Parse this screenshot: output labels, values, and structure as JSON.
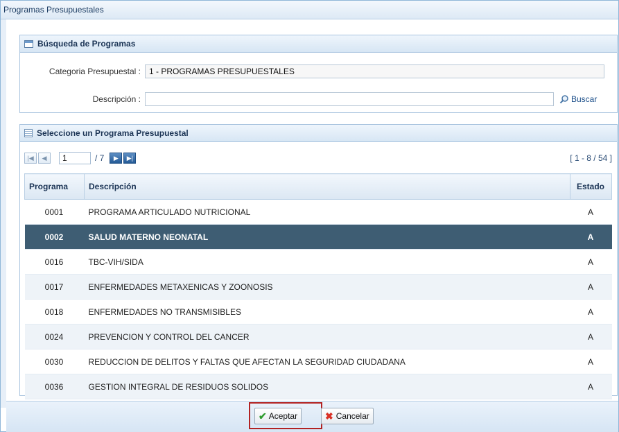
{
  "window": {
    "title": "Programas Presupuestales"
  },
  "search_panel": {
    "title": "Búsqueda de Programas",
    "categoria_label": "Categoria Presupuestal :",
    "categoria_value": "1 - PROGRAMAS PRESUPUESTALES",
    "descripcion_label": "Descripción :",
    "descripcion_value": "",
    "buscar_label": "Buscar"
  },
  "grid_panel": {
    "title": "Seleccione un Programa Presupuestal",
    "pager": {
      "current_page": "1",
      "total_pages": "/ 7",
      "range": "[ 1 - 8 / 54 ]"
    },
    "columns": [
      "Programa",
      "Descripción",
      "Estado"
    ],
    "rows": [
      {
        "programa": "0001",
        "descripcion": "PROGRAMA ARTICULADO NUTRICIONAL",
        "estado": "A"
      },
      {
        "programa": "0002",
        "descripcion": "SALUD MATERNO NEONATAL",
        "estado": "A"
      },
      {
        "programa": "0016",
        "descripcion": "TBC-VIH/SIDA",
        "estado": "A"
      },
      {
        "programa": "0017",
        "descripcion": "ENFERMEDADES METAXENICAS Y ZOONOSIS",
        "estado": "A"
      },
      {
        "programa": "0018",
        "descripcion": "ENFERMEDADES NO TRANSMISIBLES",
        "estado": "A"
      },
      {
        "programa": "0024",
        "descripcion": "PREVENCION Y CONTROL DEL CANCER",
        "estado": "A"
      },
      {
        "programa": "0030",
        "descripcion": "REDUCCION DE DELITOS Y FALTAS QUE AFECTAN LA SEGURIDAD CIUDADANA",
        "estado": "A"
      },
      {
        "programa": "0036",
        "descripcion": "GESTION INTEGRAL DE RESIDUOS SOLIDOS",
        "estado": "A"
      }
    ],
    "selected_row": 1
  },
  "footer": {
    "aceptar_label": "Aceptar",
    "cancelar_label": "Cancelar"
  },
  "icons": {
    "search": "magnifier-icon",
    "accept": "checkmark-icon",
    "cancel": "x-icon"
  },
  "colors": {
    "selected_row": "#3e5d73",
    "accent": "#1c4f8a",
    "highlight_border": "#b22222"
  }
}
